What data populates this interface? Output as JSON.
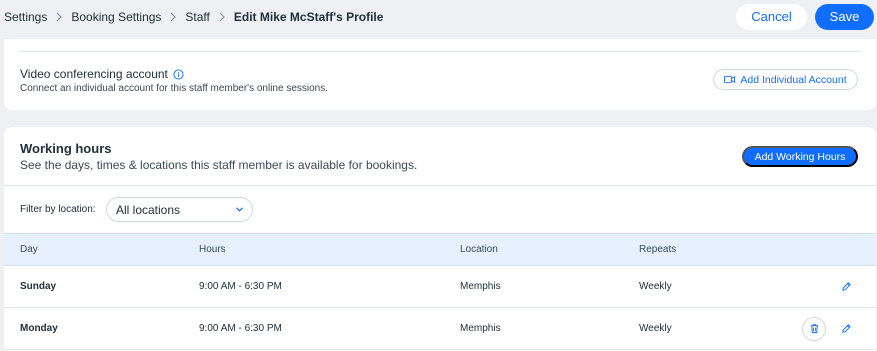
{
  "breadcrumb": [
    {
      "label": "Settings"
    },
    {
      "label": "Booking Settings"
    },
    {
      "label": "Staff"
    },
    {
      "label": "Edit Mike McStaff's Profile"
    }
  ],
  "header": {
    "cancel_label": "Cancel",
    "save_label": "Save"
  },
  "video_conferencing": {
    "title": "Video conferencing account",
    "subtitle": "Connect an individual account for this staff member's online sessions.",
    "add_account_label": "Add Individual Account"
  },
  "working_hours": {
    "title": "Working hours",
    "subtitle": "See the days, times & locations this staff member is available for bookings.",
    "add_label": "Add Working Hours",
    "filter_label": "Filter by location:",
    "filter_value": "All locations",
    "columns": [
      "Day",
      "Hours",
      "Location",
      "Repeats"
    ],
    "rows": [
      {
        "day": "Sunday",
        "hours": "9:00 AM - 6:30 PM",
        "location": "Memphis",
        "repeats": "Weekly"
      },
      {
        "day": "Monday",
        "hours": "9:00 AM - 6:30 PM",
        "location": "Memphis",
        "repeats": "Weekly"
      }
    ]
  },
  "colors": {
    "accent": "#116dff",
    "background": "#eef0f4",
    "table_header": "#e7f0ff"
  },
  "icons": [
    "chevron-right-icon",
    "info-icon",
    "video-camera-icon",
    "chevron-down-icon",
    "trash-icon",
    "pencil-icon"
  ]
}
